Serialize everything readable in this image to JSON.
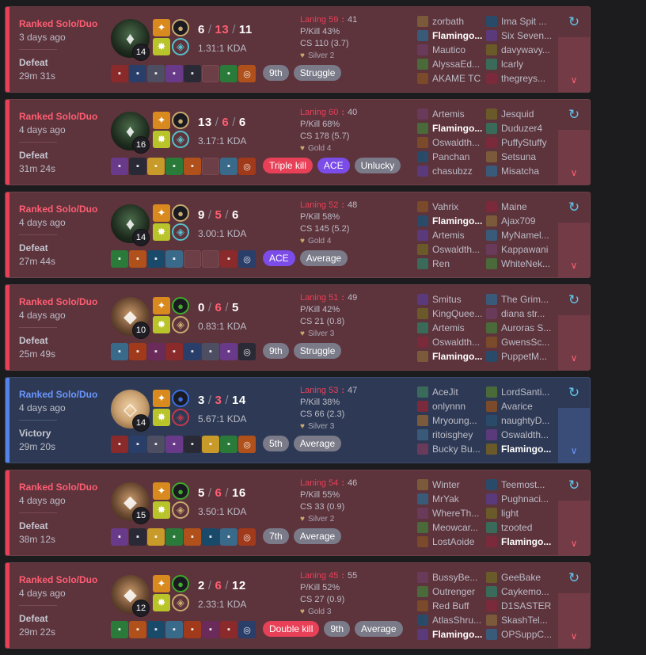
{
  "colors": {
    "defeat_bg": "#5d333c",
    "victory_bg": "#2e3a55",
    "defeat_accent": "#e84057",
    "victory_accent": "#5383e8",
    "gold": "#c8aa6e"
  },
  "icons": {
    "expand": "chevron-down-icon",
    "analyze": "sparkle-refresh-icon",
    "tier": "rank-emblem-icon"
  },
  "matches": [
    {
      "result_class": "defeat",
      "queue": "Ranked Solo/Duo",
      "ago": "3 days ago",
      "result": "Defeat",
      "duration": "29m 31s",
      "champion": "warwick",
      "level": "14",
      "kills": "6",
      "deaths": "13",
      "assists": "11",
      "kda_ratio": "1.31:1 KDA",
      "laning_label": "Laning 59",
      "laning_opp": "41",
      "pkill": "P/Kill 43%",
      "cs": "CS 110 (3.7)",
      "tier": "Silver 2",
      "badges": [
        {
          "text": "9th",
          "style": "grey"
        },
        {
          "text": "Struggle",
          "style": "grey"
        }
      ],
      "blue_team": [
        "zorbath",
        "Flamingo...",
        "Mautico",
        "AlyssaEd...",
        "AKAME TC"
      ],
      "red_team": [
        "Ima Spit ...",
        "Six Seven...",
        "davywavy...",
        "lcarly",
        "thegreys..."
      ],
      "me_blue_index": 1,
      "me_red_index": -1
    },
    {
      "result_class": "defeat",
      "queue": "Ranked Solo/Duo",
      "ago": "4 days ago",
      "result": "Defeat",
      "duration": "31m 24s",
      "champion": "warwick",
      "level": "16",
      "kills": "13",
      "deaths": "6",
      "assists": "6",
      "kda_ratio": "3.17:1 KDA",
      "laning_label": "Laning 60",
      "laning_opp": "40",
      "pkill": "P/Kill 68%",
      "cs": "CS 178 (5.7)",
      "tier": "Gold 4",
      "badges": [
        {
          "text": "Triple kill",
          "style": "red"
        },
        {
          "text": "ACE",
          "style": "purple"
        },
        {
          "text": "Unlucky",
          "style": "grey"
        }
      ],
      "blue_team": [
        "Artemis",
        "Flamingo...",
        "Oswaldth...",
        "Panchan",
        "chasubzz"
      ],
      "red_team": [
        "Jesquid",
        "Duduzer4",
        "PuffyStuffy",
        "Setsuna",
        "Misatcha"
      ],
      "me_blue_index": 1,
      "me_red_index": -1
    },
    {
      "result_class": "defeat",
      "queue": "Ranked Solo/Duo",
      "ago": "4 days ago",
      "result": "Defeat",
      "duration": "27m 44s",
      "champion": "warwick",
      "level": "14",
      "kills": "9",
      "deaths": "5",
      "assists": "6",
      "kda_ratio": "3.00:1 KDA",
      "laning_label": "Laning 52",
      "laning_opp": "48",
      "pkill": "P/Kill 58%",
      "cs": "CS 145 (5.2)",
      "tier": "Gold 4",
      "badges": [
        {
          "text": "ACE",
          "style": "purple"
        },
        {
          "text": "Average",
          "style": "grey"
        }
      ],
      "blue_team": [
        "Vahrix",
        "Flamingo...",
        "Artemis",
        "Oswaldth...",
        "Ren"
      ],
      "red_team": [
        "Maine",
        "Ajax709",
        "MyNamel...",
        "Kappawani",
        "WhiteNek..."
      ],
      "me_blue_index": 1,
      "me_red_index": -1
    },
    {
      "result_class": "defeat",
      "queue": "Ranked Solo/Duo",
      "ago": "4 days ago",
      "result": "Defeat",
      "duration": "25m 49s",
      "champion": "female",
      "level": "10",
      "kills": "0",
      "deaths": "6",
      "assists": "5",
      "kda_ratio": "0.83:1 KDA",
      "laning_label": "Laning 51",
      "laning_opp": "49",
      "pkill": "P/Kill 42%",
      "cs": "CS 21 (0.8)",
      "tier": "Silver 3",
      "badges": [
        {
          "text": "9th",
          "style": "grey"
        },
        {
          "text": "Struggle",
          "style": "grey"
        }
      ],
      "blue_team": [
        "Smitus",
        "KingQuee...",
        "Artemis",
        "Oswaldth...",
        "Flamingo..."
      ],
      "red_team": [
        "The Grim...",
        "diana str...",
        "Auroras S...",
        "GwensSc...",
        "PuppetM..."
      ],
      "me_blue_index": 4,
      "me_red_index": -1
    },
    {
      "result_class": "victory",
      "queue": "Ranked Solo/Duo",
      "ago": "4 days ago",
      "result": "Victory",
      "duration": "29m 20s",
      "champion": "blonde",
      "level": "14",
      "kills": "3",
      "deaths": "3",
      "assists": "14",
      "kda_ratio": "5.67:1 KDA",
      "laning_label": "Laning 53",
      "laning_opp": "47",
      "pkill": "P/Kill 38%",
      "cs": "CS 66 (2.3)",
      "tier": "Silver 3",
      "badges": [
        {
          "text": "5th",
          "style": "grey"
        },
        {
          "text": "Average",
          "style": "grey"
        }
      ],
      "blue_team": [
        "AceJit",
        "onlynnn",
        "Mryoung...",
        "ritoisghey",
        "Bucky Bu..."
      ],
      "red_team": [
        "LordSanti...",
        "Avarice",
        "naughtyD...",
        "Oswaldth...",
        "Flamingo..."
      ],
      "me_blue_index": -1,
      "me_red_index": 4
    },
    {
      "result_class": "defeat",
      "queue": "Ranked Solo/Duo",
      "ago": "4 days ago",
      "result": "Defeat",
      "duration": "38m 12s",
      "champion": "female",
      "level": "15",
      "kills": "5",
      "deaths": "6",
      "assists": "16",
      "kda_ratio": "3.50:1 KDA",
      "laning_label": "Laning 54",
      "laning_opp": "46",
      "pkill": "P/Kill 55%",
      "cs": "CS 33 (0.9)",
      "tier": "Silver 2",
      "badges": [
        {
          "text": "7th",
          "style": "grey"
        },
        {
          "text": "Average",
          "style": "grey"
        }
      ],
      "blue_team": [
        "Winter",
        "MrYak",
        "WhereTh...",
        "Meowcar...",
        "LostAoide"
      ],
      "red_team": [
        "Teemost...",
        "Pughnaci...",
        "light",
        "tzooted",
        "Flamingo..."
      ],
      "me_blue_index": -1,
      "me_red_index": 4
    },
    {
      "result_class": "defeat",
      "queue": "Ranked Solo/Duo",
      "ago": "4 days ago",
      "result": "Defeat",
      "duration": "29m 22s",
      "champion": "female",
      "level": "12",
      "kills": "2",
      "deaths": "6",
      "assists": "12",
      "kda_ratio": "2.33:1 KDA",
      "laning_label": "Laning 45",
      "laning_opp": "55",
      "pkill": "P/Kill 52%",
      "cs": "CS 27 (0.9)",
      "tier": "Gold 3",
      "badges": [
        {
          "text": "Double kill",
          "style": "red"
        },
        {
          "text": "9th",
          "style": "grey"
        },
        {
          "text": "Average",
          "style": "grey"
        }
      ],
      "blue_team": [
        "BussyBe...",
        "Outrenger",
        "Red Buff",
        "AtlasShru...",
        "Flamingo..."
      ],
      "red_team": [
        "GeeBake",
        "Caykemo...",
        "D1SASTER",
        "SkashTel...",
        "OPSuppC..."
      ],
      "me_blue_index": 4,
      "me_red_index": -1
    }
  ]
}
